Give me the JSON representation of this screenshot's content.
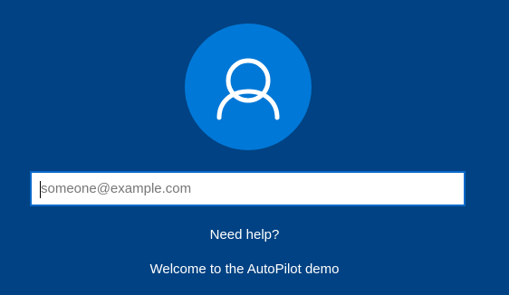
{
  "colors": {
    "background": "#004283",
    "avatar_circle": "#0078d7",
    "input_border": "#0a69c9",
    "text": "#ffffff"
  },
  "avatar": {
    "icon": "user-icon"
  },
  "login": {
    "email_value": "",
    "email_placeholder": "someone@example.com"
  },
  "help": {
    "label": "Need help?"
  },
  "welcome": {
    "message": "Welcome to the AutoPilot demo"
  }
}
